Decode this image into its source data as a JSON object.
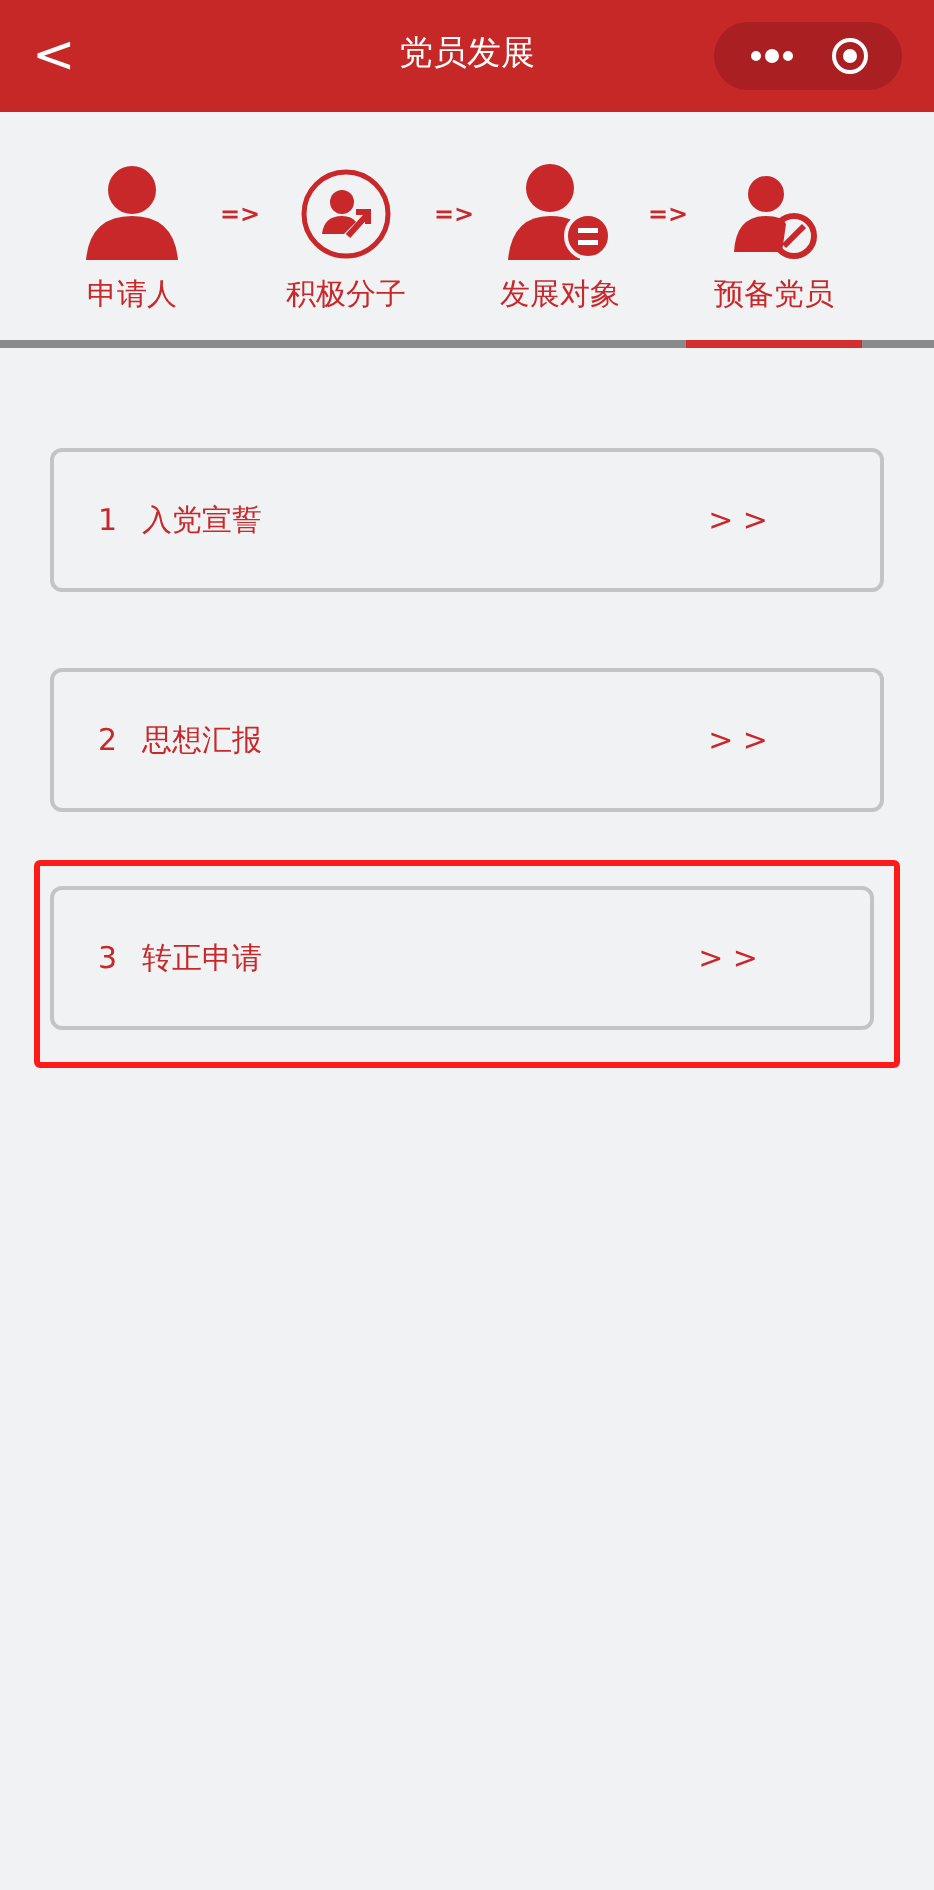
{
  "header": {
    "back": "<",
    "title": "党员发展"
  },
  "steps": [
    {
      "kind": "person",
      "label": "申请人",
      "selected": false,
      "arrow": "=>"
    },
    {
      "kind": "activist",
      "label": "积极分子",
      "selected": false,
      "arrow": "=>"
    },
    {
      "kind": "target",
      "label": "发展对象",
      "selected": false,
      "arrow": "=>"
    },
    {
      "kind": "probationary",
      "label": "预备党员",
      "selected": true
    }
  ],
  "items": [
    {
      "number": "1",
      "label": "入党宣誓",
      "chevron": "> >",
      "highlighted": false
    },
    {
      "number": "2",
      "label": "思想汇报",
      "chevron": "> >",
      "highlighted": false
    },
    {
      "number": "3",
      "label": "转正申请",
      "chevron": "> >",
      "highlighted": true
    }
  ]
}
